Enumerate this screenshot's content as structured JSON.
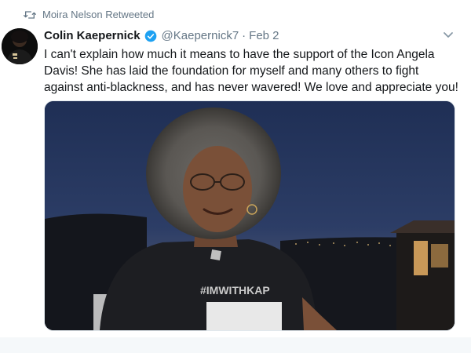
{
  "retweet": {
    "icon": "retweet-icon",
    "label": "Moira Nelson Retweeted"
  },
  "author": {
    "display_name": "Colin Kaepernick",
    "verified_icon": "verified-badge-icon",
    "handle": "@Kaepernick7",
    "separator": "·",
    "date": "Feb 2"
  },
  "menu_icon": "chevron-down-icon",
  "tweet_text": "I can't explain how much it means to have the support of the Icon Angela Davis! She has laid the foundation for myself and many others to fight against anti-blackness, and has never wavered! We love and appreciate you!",
  "media": {
    "shirt_text": "#IMWITHKAP"
  },
  "colors": {
    "accent": "#1da1f2",
    "muted": "#657786"
  }
}
